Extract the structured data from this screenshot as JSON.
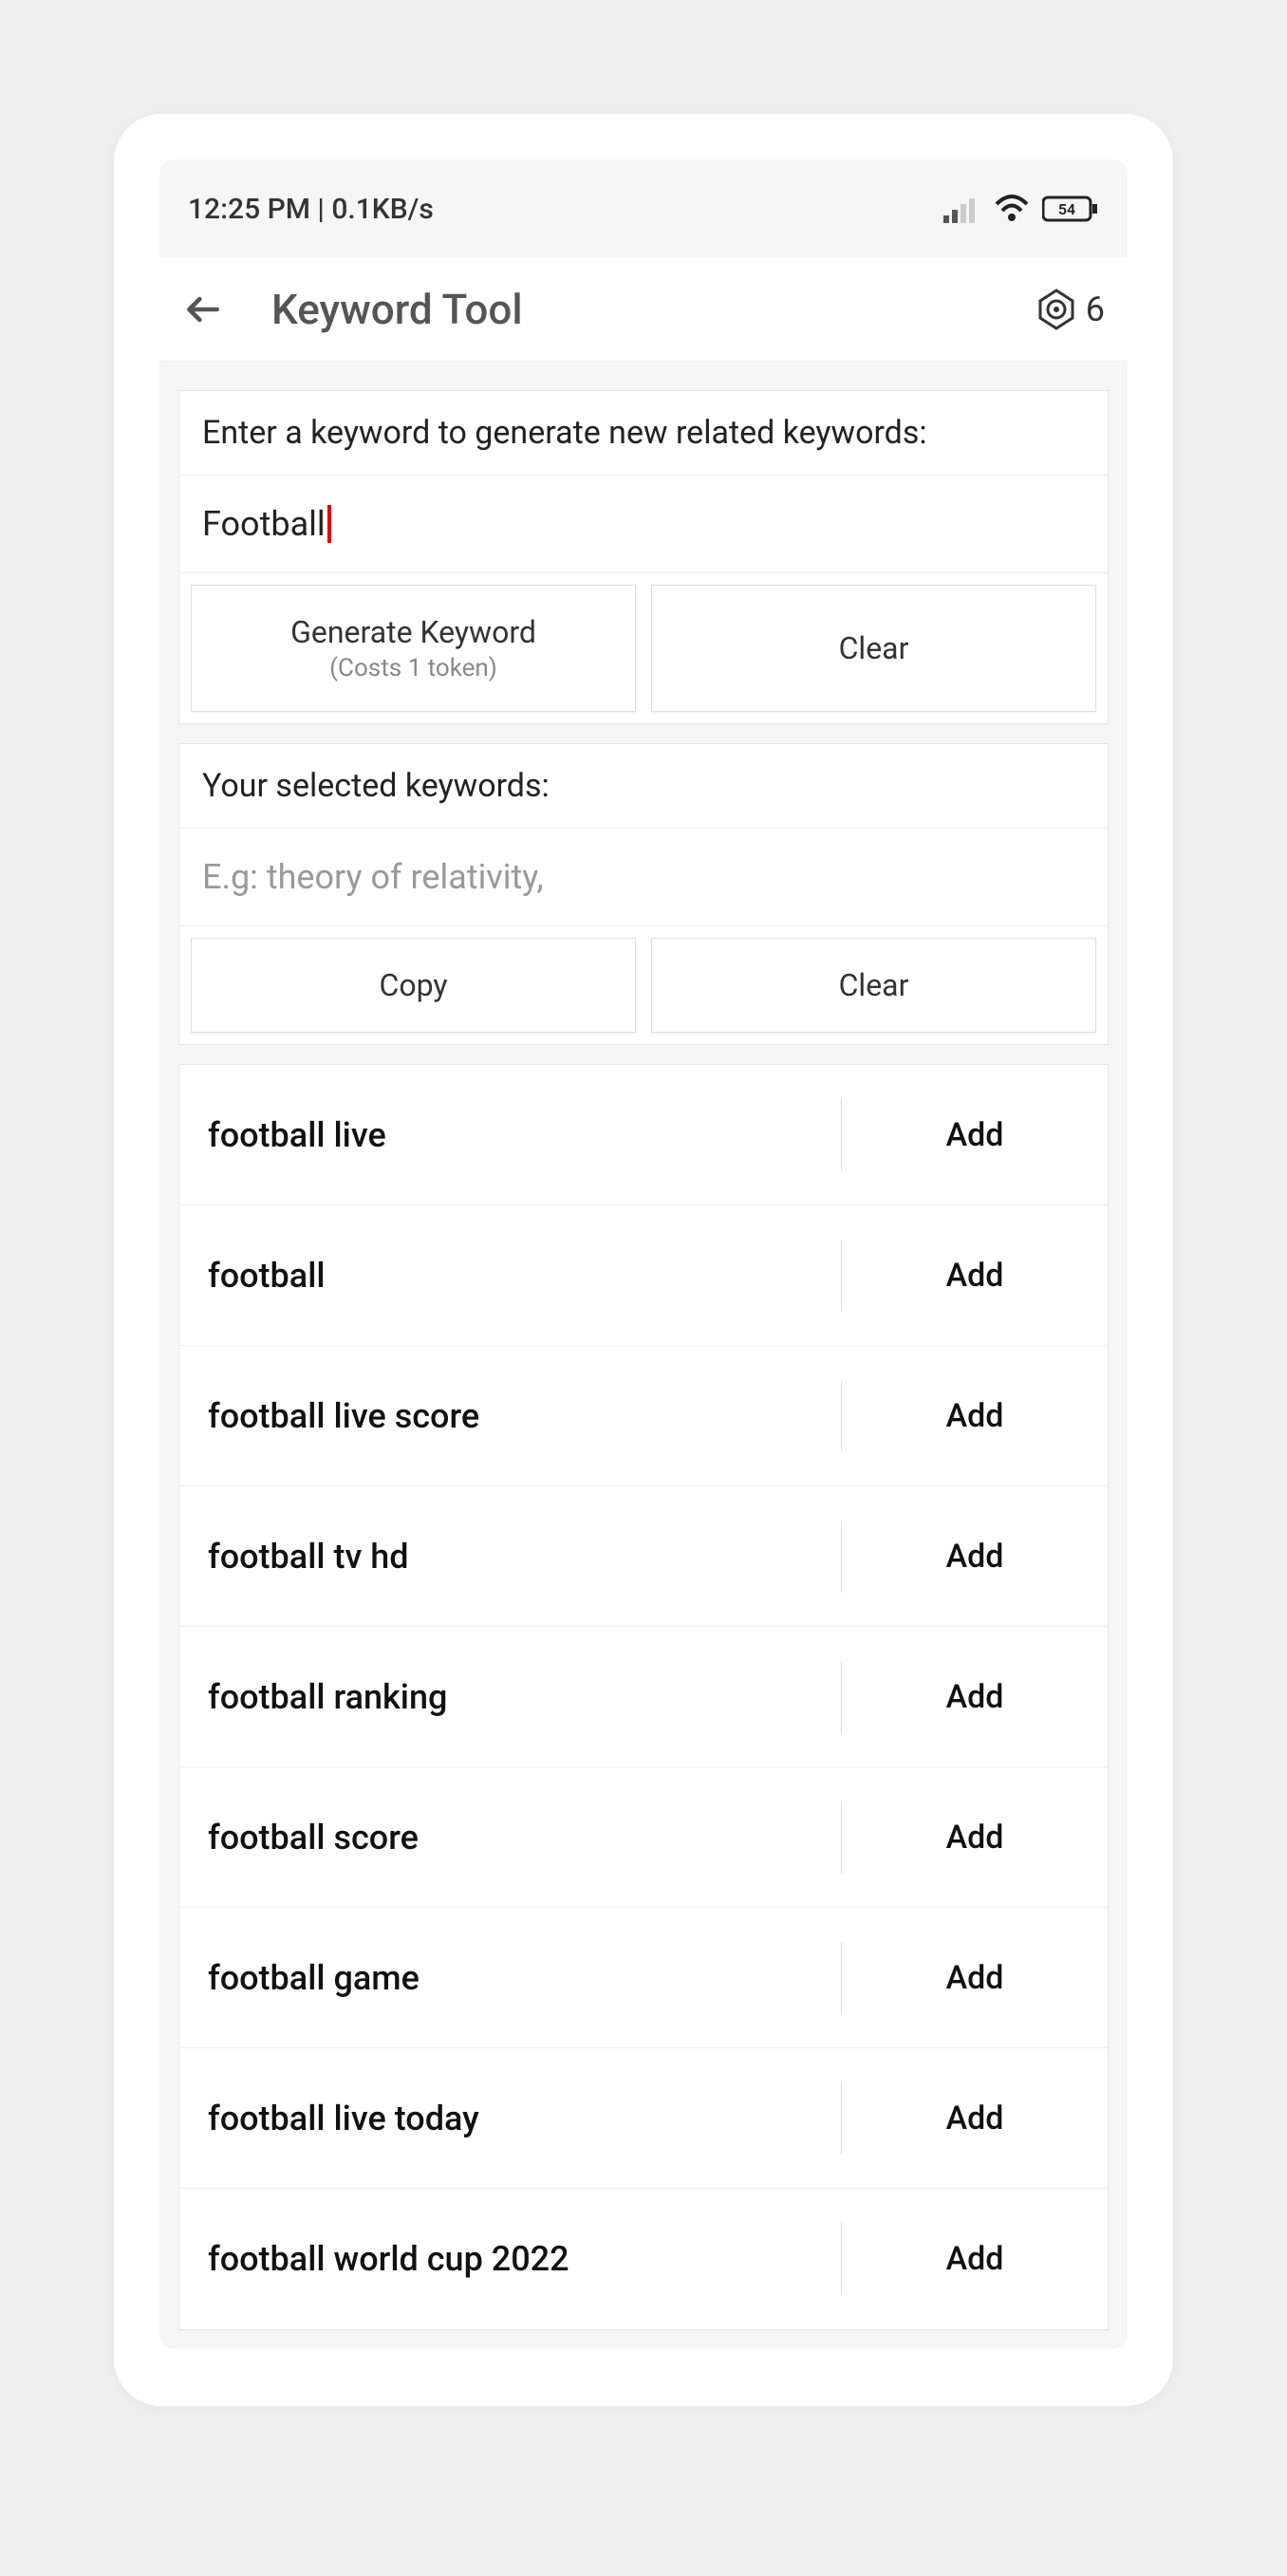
{
  "status_bar": {
    "time_text": "12:25 PM | 0.1KB/s",
    "battery": "54"
  },
  "header": {
    "title": "Keyword Tool",
    "token_count": "6"
  },
  "input_panel": {
    "label": "Enter a keyword to generate new related keywords:",
    "value": "Football",
    "generate_label": "Generate Keyword",
    "generate_sub": "(Costs 1 token)",
    "clear_label": "Clear"
  },
  "selected_panel": {
    "label": "Your selected keywords:",
    "placeholder": "E.g: theory of relativity,",
    "copy_label": "Copy",
    "clear_label": "Clear"
  },
  "results": {
    "add_label": "Add",
    "items": [
      "football live",
      "football",
      "football live score",
      "football tv hd",
      "football ranking",
      "football score",
      "football game",
      "football live today",
      "football world cup 2022"
    ]
  }
}
